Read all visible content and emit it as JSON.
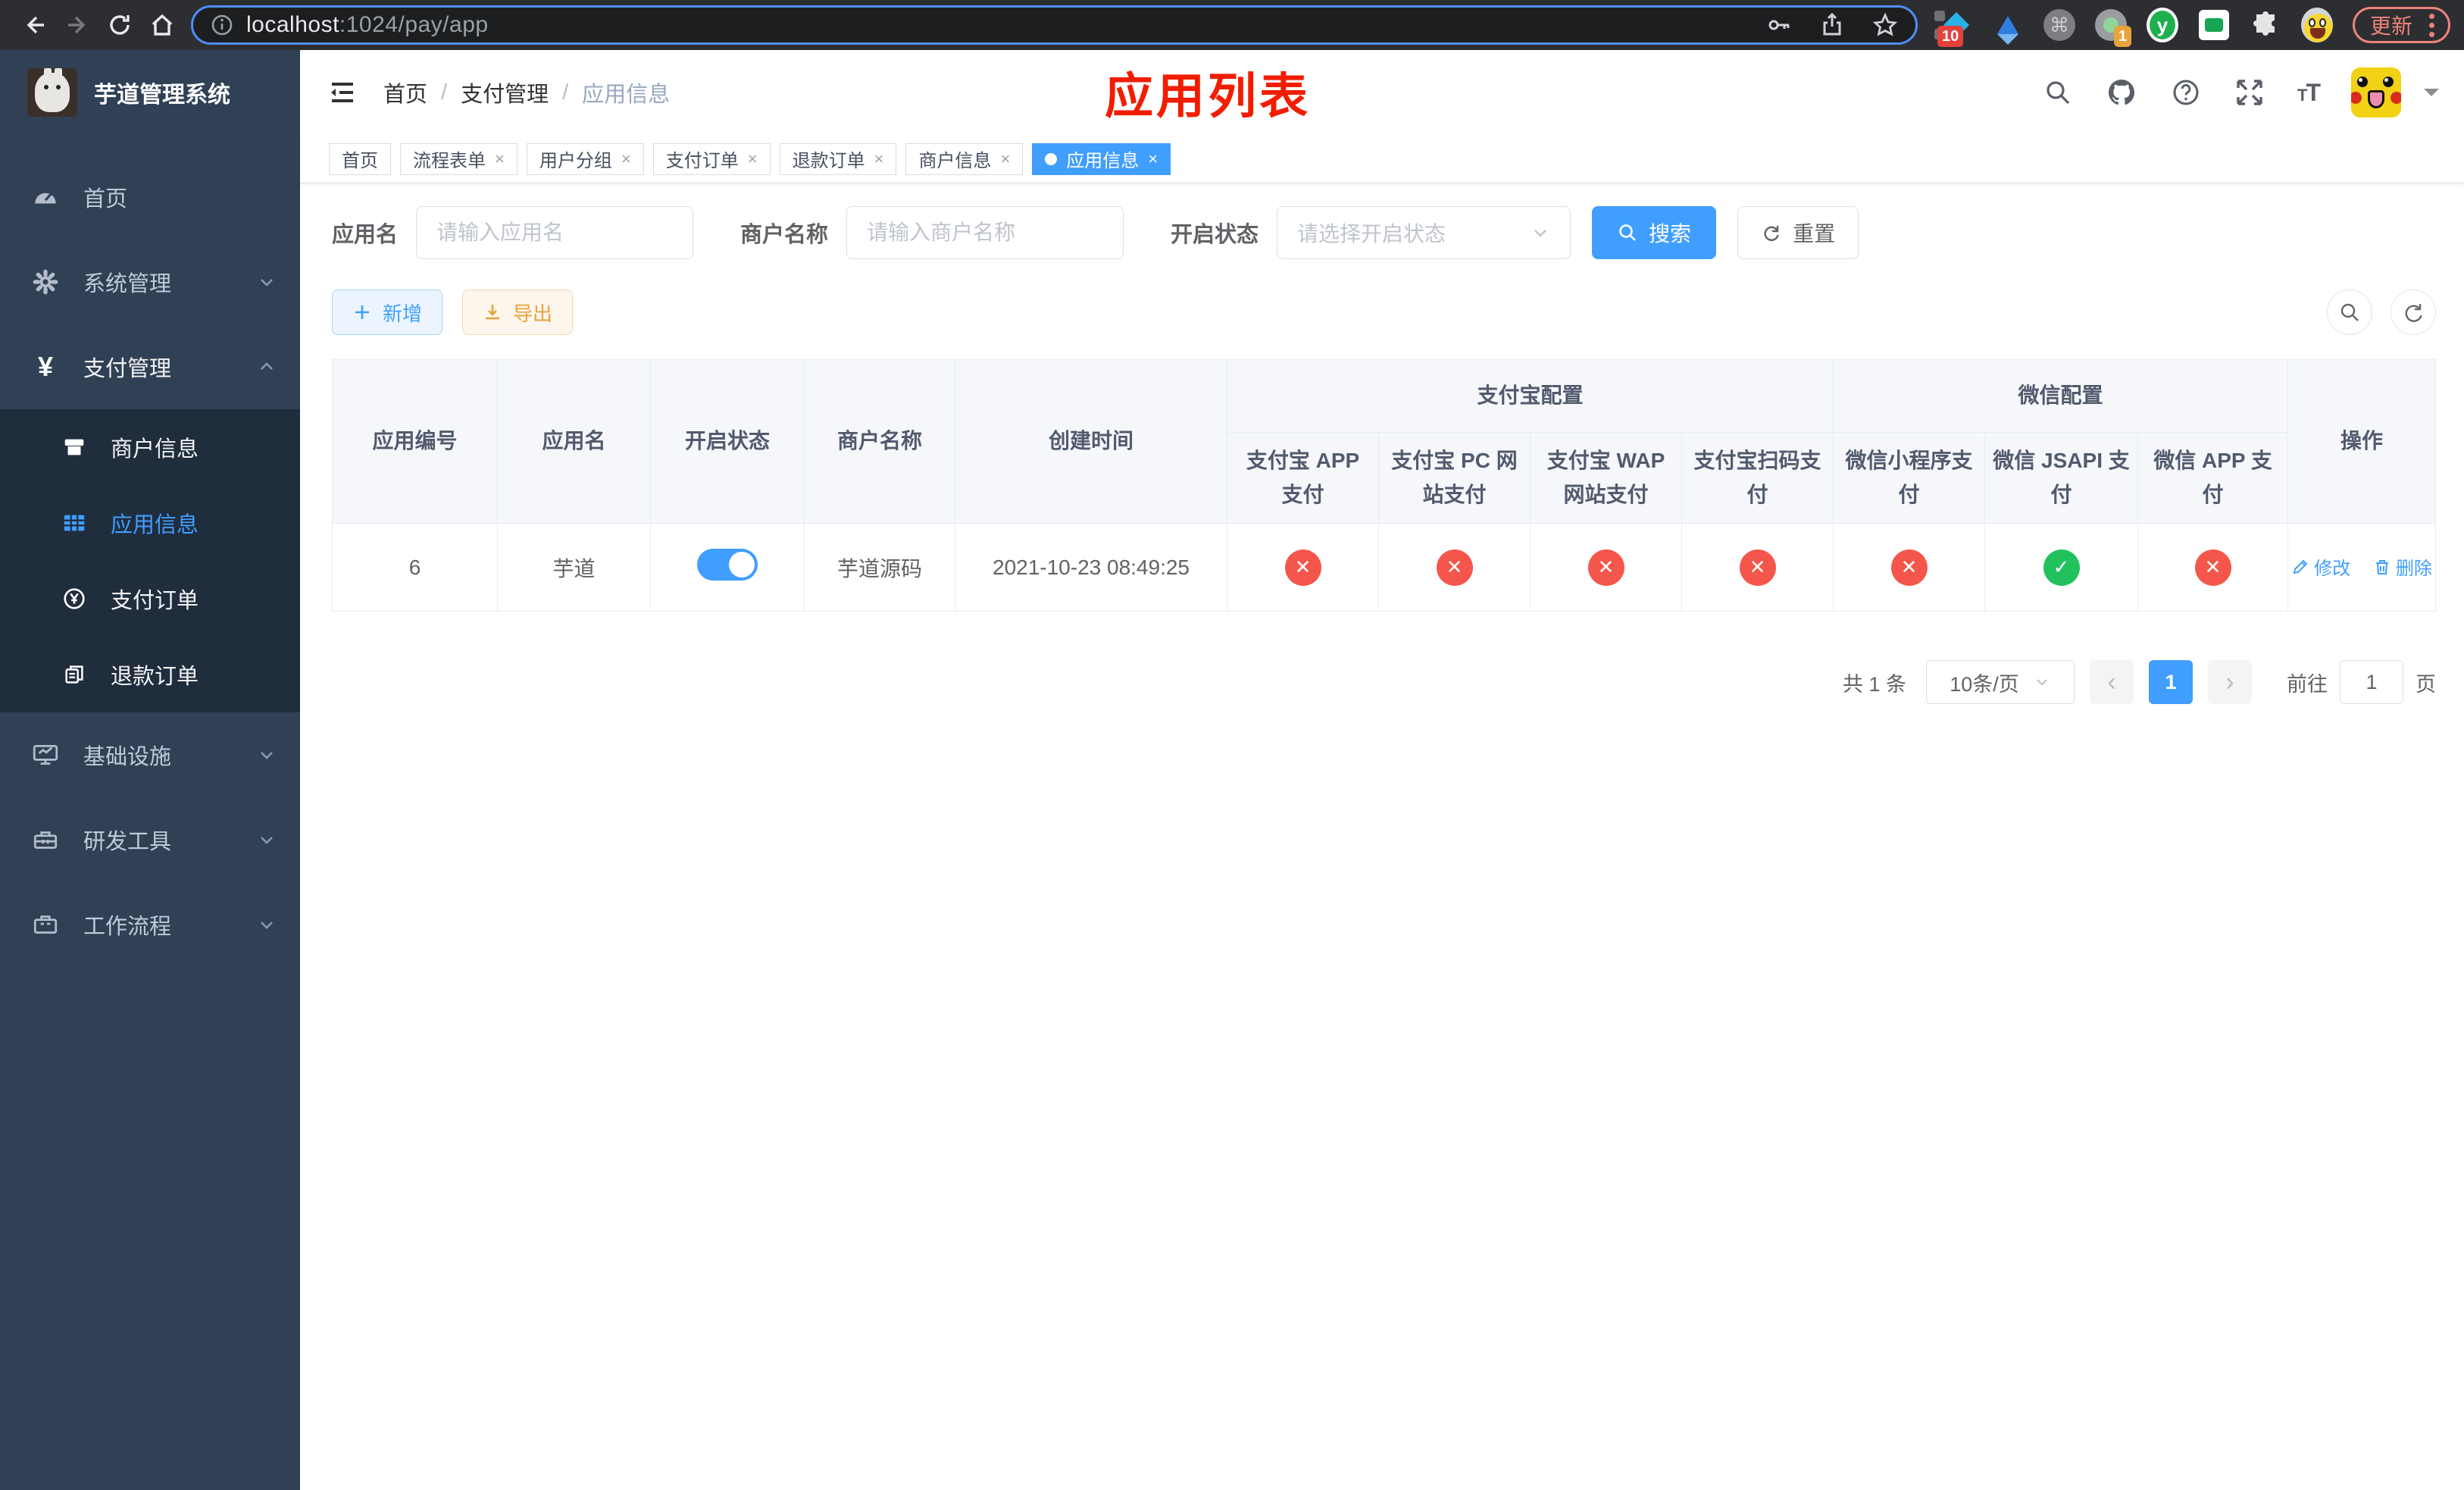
{
  "colors": {
    "accent": "#409eff",
    "annotation_red": "#f21d00",
    "status_red": "#f5564b",
    "status_green": "#21c25d",
    "export_orange": "#e6a23c"
  },
  "browser": {
    "url_host": "localhost",
    "url_rest": ":1024/pay/app",
    "update_label": "更新",
    "ext_badge_blue_diamond": "10",
    "ext_badge_green_dot": "1"
  },
  "sidebar": {
    "title": "芋道管理系统",
    "items": [
      {
        "label": "首页"
      },
      {
        "label": "系统管理"
      },
      {
        "label": "支付管理"
      },
      {
        "label": "商户信息"
      },
      {
        "label": "应用信息"
      },
      {
        "label": "支付订单"
      },
      {
        "label": "退款订单"
      },
      {
        "label": "基础设施"
      },
      {
        "label": "研发工具"
      },
      {
        "label": "工作流程"
      }
    ]
  },
  "breadcrumb": {
    "items": [
      "首页",
      "支付管理",
      "应用信息"
    ]
  },
  "annotation": {
    "title": "应用列表"
  },
  "tags": [
    {
      "label": "首页",
      "closable": false,
      "active": false
    },
    {
      "label": "流程表单",
      "closable": true,
      "active": false
    },
    {
      "label": "用户分组",
      "closable": true,
      "active": false
    },
    {
      "label": "支付订单",
      "closable": true,
      "active": false
    },
    {
      "label": "退款订单",
      "closable": true,
      "active": false
    },
    {
      "label": "商户信息",
      "closable": true,
      "active": false
    },
    {
      "label": "应用信息",
      "closable": true,
      "active": true
    }
  ],
  "filters": {
    "app_name_label": "应用名",
    "app_name_placeholder": "请输入应用名",
    "merchant_label": "商户名称",
    "merchant_placeholder": "请输入商户名称",
    "status_label": "开启状态",
    "status_placeholder": "请选择开启状态",
    "search_label": "搜索",
    "reset_label": "重置"
  },
  "toolbar": {
    "add_label": "新增",
    "export_label": "导出"
  },
  "table": {
    "columns": [
      "应用编号",
      "应用名",
      "开启状态",
      "商户名称",
      "创建时间"
    ],
    "group_alipay": "支付宝配置",
    "group_wechat": "微信配置",
    "alipay_columns": [
      "支付宝 APP 支付",
      "支付宝 PC 网站支付",
      "支付宝 WAP 网站支付",
      "支付宝扫码支付"
    ],
    "wechat_columns": [
      "微信小程序支付",
      "微信 JSAPI 支付",
      "微信 APP 支付"
    ],
    "actions_column": "操作",
    "row": {
      "id": "6",
      "name": "芋道",
      "enabled": true,
      "merchant": "芋道源码",
      "created_at": "2021-10-23 08:49:25",
      "statuses": [
        false,
        false,
        false,
        false,
        false,
        true,
        false
      ],
      "edit_label": "修改",
      "delete_label": "删除"
    }
  },
  "pagination": {
    "total": "共 1 条",
    "page_size": "10条/页",
    "page": "1",
    "prev": "‹",
    "next": "›",
    "jump_prefix": "前往",
    "jump_value": "1",
    "jump_suffix": "页"
  }
}
